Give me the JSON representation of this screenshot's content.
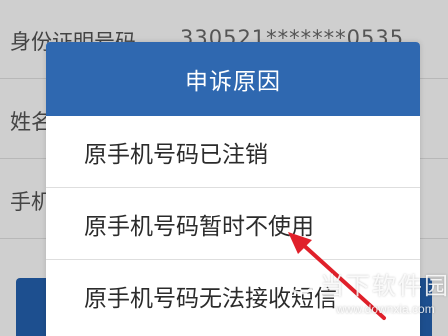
{
  "background_form": {
    "rows": [
      {
        "label": "身份证明号码",
        "value": "330521*******0535"
      },
      {
        "label": "姓名",
        "value": ""
      },
      {
        "label": "手机",
        "value": ""
      }
    ]
  },
  "dialog": {
    "title": "申诉原因",
    "options": [
      "原手机号码已注销",
      "原手机号码暂时不使用",
      "原手机号码无法接收短信"
    ]
  },
  "annotation": {
    "arrow_color": "#e0202a",
    "points_to": "原手机号码暂时不使用"
  },
  "watermark": {
    "text": "当下软件园",
    "url": "www.downxia.com"
  },
  "colors": {
    "header": "#2f68b0",
    "overlay": "#cfcfcf"
  }
}
